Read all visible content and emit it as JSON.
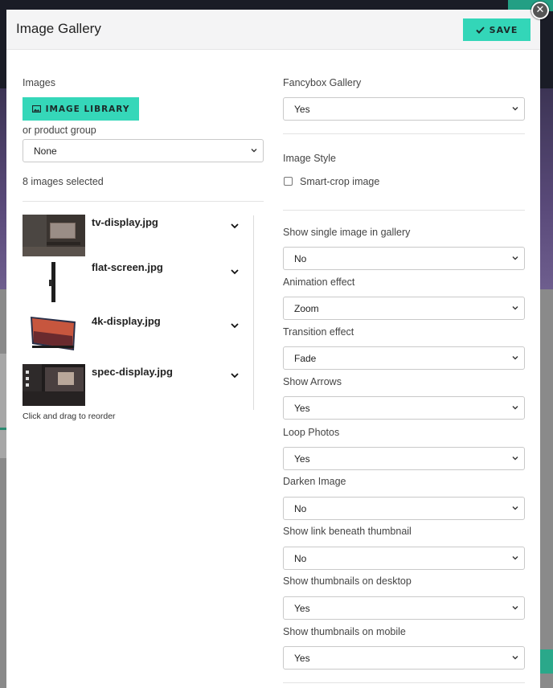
{
  "modal": {
    "title": "Image Gallery",
    "save_label": "SAVE",
    "close_label": "✕"
  },
  "left": {
    "images_label": "Images",
    "library_button": "IMAGE LIBRARY",
    "product_group_label": "or product group",
    "product_group_value": "None",
    "selected_count": "8 images selected",
    "images": [
      {
        "filename": "tv-display.jpg"
      },
      {
        "filename": "flat-screen.jpg"
      },
      {
        "filename": "4k-display.jpg"
      },
      {
        "filename": "spec-display.jpg"
      }
    ],
    "reorder_hint": "Click and drag to reorder"
  },
  "right": {
    "fancybox_label": "Fancybox Gallery",
    "fancybox_value": "Yes",
    "image_style_label": "Image Style",
    "smart_crop_label": "Smart-crop image",
    "smart_crop_checked": false,
    "fields": [
      {
        "label": "Show single image in gallery",
        "value": "No"
      },
      {
        "label": "Animation effect",
        "value": "Zoom"
      },
      {
        "label": "Transition effect",
        "value": "Fade"
      },
      {
        "label": "Show Arrows",
        "value": "Yes"
      },
      {
        "label": "Loop Photos",
        "value": "Yes"
      },
      {
        "label": "Darken Image",
        "value": "No"
      },
      {
        "label": "Show link beneath thumbnail",
        "value": "No"
      },
      {
        "label": "Show thumbnails on desktop",
        "value": "Yes"
      },
      {
        "label": "Show thumbnails on mobile",
        "value": "Yes"
      }
    ]
  },
  "colors": {
    "accent": "#35d7b9",
    "header_bg": "#f4f4f5"
  },
  "icons": {
    "save": "check-icon",
    "library": "image-icon",
    "select": "chevron-down-icon",
    "expand": "chevron-down-icon",
    "close": "close-icon"
  }
}
